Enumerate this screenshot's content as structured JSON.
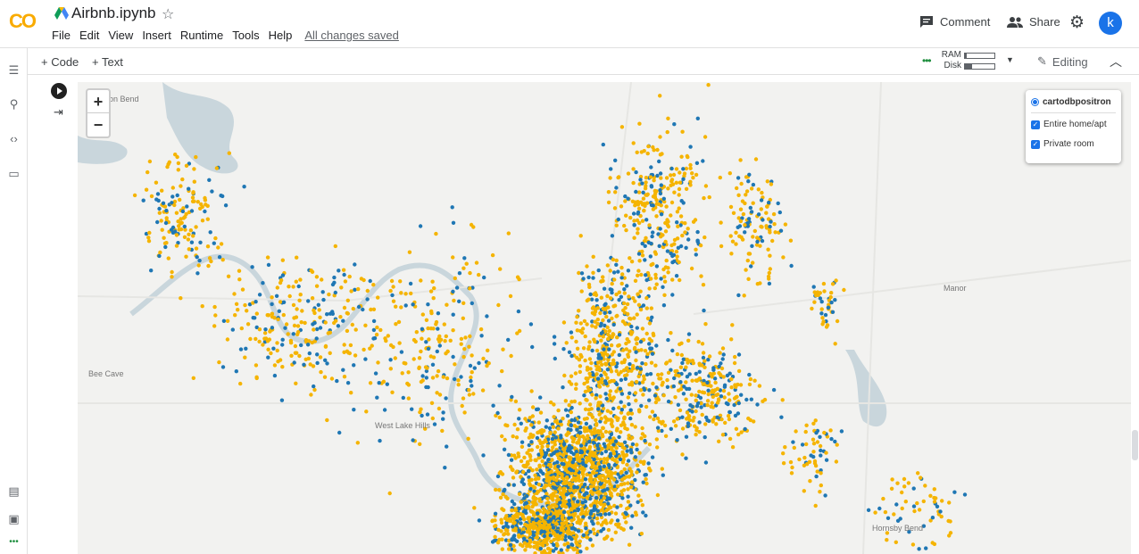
{
  "app": {
    "logo": "CO",
    "title": "Airbnb.ipynb",
    "saved_status": "All changes saved"
  },
  "menu": [
    "File",
    "Edit",
    "View",
    "Insert",
    "Runtime",
    "Tools",
    "Help"
  ],
  "header": {
    "comment_label": "Comment",
    "share_label": "Share",
    "avatar_letter": "k"
  },
  "toolbar": {
    "add_code": "+ Code",
    "add_text": "+ Text",
    "ram_label": "RAM",
    "disk_label": "Disk",
    "ram_fill": 0.05,
    "disk_fill": 0.25,
    "editing_label": "Editing"
  },
  "sidebar_icons": [
    "toc-icon",
    "search-icon",
    "code-snippets-icon",
    "folder-icon",
    "command-palette-icon",
    "terminal-icon"
  ],
  "map": {
    "layer_control": {
      "base_layer": "cartodbpositron",
      "overlays": [
        "Entire home/apt",
        "Private room"
      ]
    },
    "zoom_in": "+",
    "zoom_out": "−",
    "place_labels": [
      "Hudson Bend",
      "Bee Cave",
      "West Lake Hills",
      "Manor",
      "Hornsby Bend"
    ],
    "colors": {
      "entire_home": "#f5b400",
      "private_room": "#1f77b4",
      "water": "#c9d6dc"
    }
  }
}
